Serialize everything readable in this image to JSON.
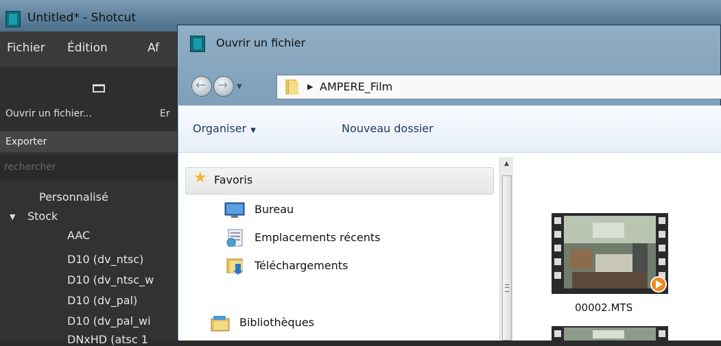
{
  "shotcut": {
    "title": "Untitled* - Shotcut",
    "menus": [
      "Fichier",
      "Édition",
      "Af"
    ],
    "toolbar": {
      "open_label": "Ouvrir un fichier...",
      "next_label": "Er"
    },
    "export_header": "Exporter",
    "search_placeholder": "rechercher",
    "tree": {
      "custom": "Personnalisé",
      "stock": "Stock",
      "items": [
        "AAC",
        "D10 (dv_ntsc)",
        "D10 (dv_ntsc_w",
        "D10 (dv_pal)",
        "D10 (dv_pal_wi",
        "DNxHD (atsc 1"
      ]
    }
  },
  "dialog": {
    "title": "Ouvrir un fichier",
    "address": {
      "path": "AMPERE_Film"
    },
    "commands": {
      "organize": "Organiser",
      "new_folder": "Nouveau dossier"
    },
    "nav": {
      "favorites": "Favoris",
      "items": [
        "Bureau",
        "Emplacements récents",
        "Téléchargements"
      ],
      "libraries": "Bibliothèques"
    },
    "files": [
      {
        "name": "00002.MTS"
      }
    ]
  },
  "colors": {
    "dialog_chrome": "#7597b3",
    "shotcut_bg": "#323232",
    "selection": "#e6e6e6",
    "command_text": "#1e395b"
  }
}
